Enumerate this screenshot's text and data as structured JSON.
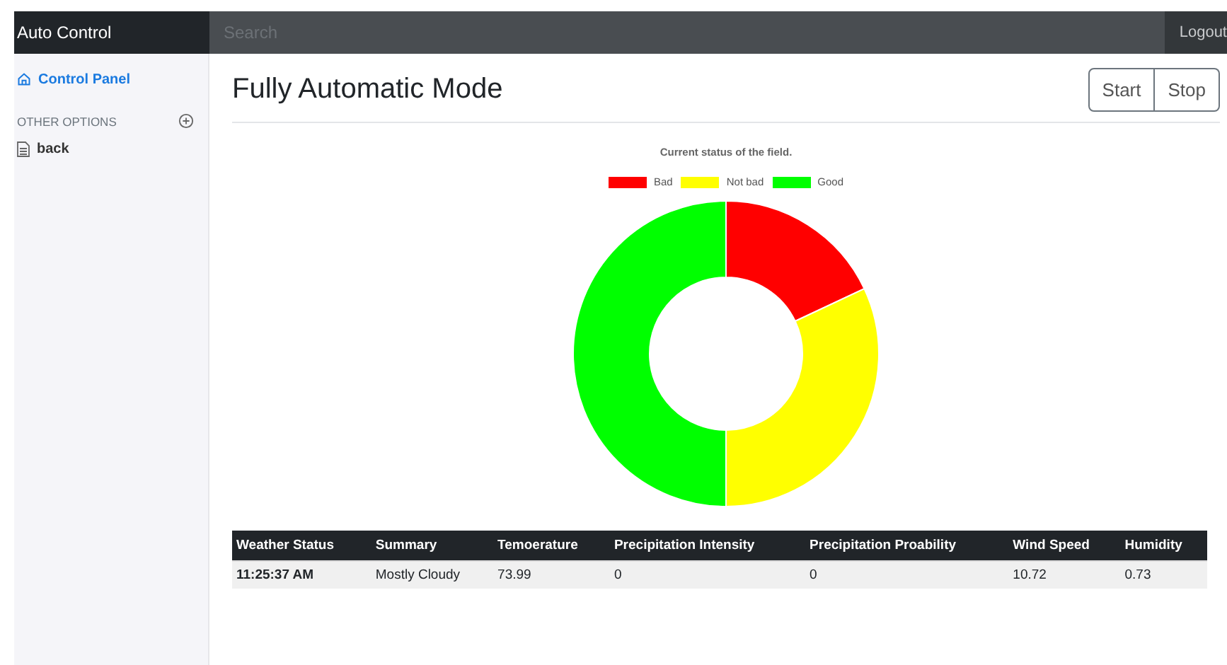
{
  "navbar": {
    "brand": "Auto Control",
    "search": {
      "placeholder": "Search"
    },
    "logout": "Logout"
  },
  "sidebar": {
    "items": [
      {
        "label": "Control Panel",
        "selected": true
      }
    ],
    "section": "OTHER OPTIONS",
    "links": [
      {
        "label": "back"
      }
    ]
  },
  "main": {
    "title": "Fully Automatic Mode",
    "buttons": [
      "Start",
      "Stop"
    ],
    "chart": {
      "chart_data": {
        "type": "donut",
        "title": "Current status of the field.",
        "categories": [
          "Bad",
          "Not bad",
          "Good"
        ],
        "values": [
          18,
          32,
          50
        ],
        "legend": "top",
        "colors": [
          "#ff0000",
          "#ffff00",
          "#00ff00"
        ]
      }
    },
    "table": {
      "columns": [
        "Weather Status",
        "Summary",
        "Temoerature",
        "Precipitation Intensity",
        "Precipitation Proability",
        "Wind Speed",
        "Humidity"
      ],
      "rows": [
        [
          "11:25:37 AM",
          "Mostly Cloudy",
          "73.99",
          "0",
          "0",
          "10.72",
          "0.73"
        ]
      ]
    }
  }
}
